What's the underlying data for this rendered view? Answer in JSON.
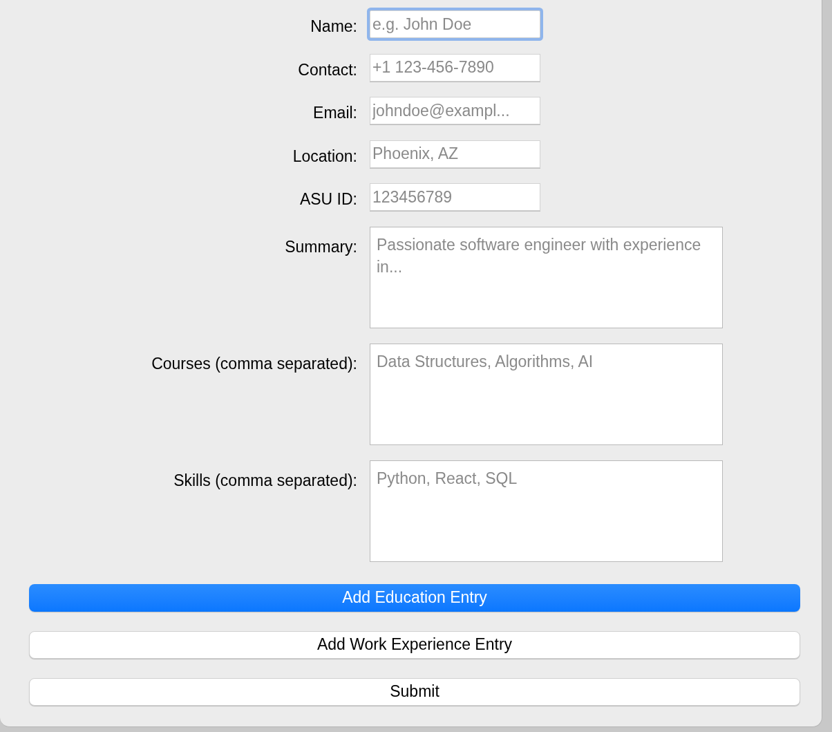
{
  "fields": [
    {
      "kind": "line",
      "label": "Name:",
      "placeholder": "e.g. John Doe",
      "focused": true
    },
    {
      "kind": "line",
      "label": "Contact:",
      "placeholder": "+1 123-456-7890",
      "focused": false
    },
    {
      "kind": "line",
      "label": "Email:",
      "placeholder": "johndoe@exampl...",
      "focused": false
    },
    {
      "kind": "line",
      "label": "Location:",
      "placeholder": "Phoenix, AZ",
      "focused": false
    },
    {
      "kind": "line",
      "label": "ASU ID:",
      "placeholder": "123456789",
      "focused": false
    },
    {
      "kind": "area",
      "label": "Summary:",
      "placeholder": "Passionate software engineer with experience in...",
      "focused": false
    },
    {
      "kind": "area",
      "label": "Courses (comma separated):",
      "placeholder": "Data Structures, Algorithms, AI",
      "focused": false
    },
    {
      "kind": "area",
      "label": "Skills (comma separated):",
      "placeholder": "Python, React, SQL",
      "focused": false
    }
  ],
  "buttons": [
    {
      "label": "Add Education Entry",
      "default": true
    },
    {
      "label": "Add Work Experience Entry",
      "default": false
    },
    {
      "label": "Submit",
      "default": false
    }
  ]
}
